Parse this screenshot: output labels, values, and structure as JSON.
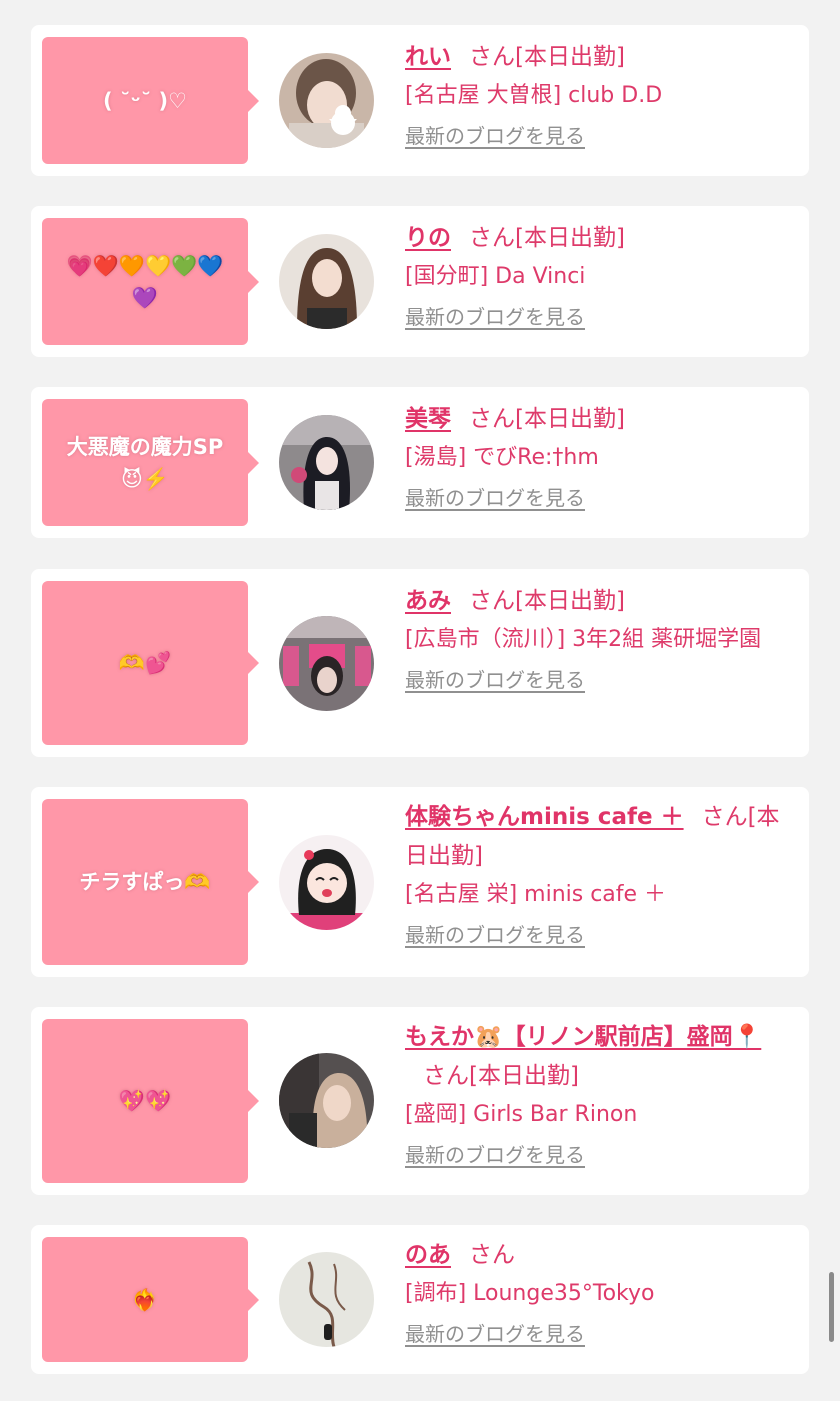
{
  "colors": {
    "bubble": "#ff97a8",
    "accent": "#e03468",
    "link_gray": "#909090",
    "background": "#f2f2f2"
  },
  "entries": [
    {
      "bubble_lines": [
        "( ˘ᵕ˘ )♡"
      ],
      "avatar_icon": "portrait-photo",
      "name": "れい",
      "san": "さん",
      "status": "[本日出勤]",
      "shop": "[名古屋 大曽根] club D.D",
      "blog_link": "最新のブログを見る"
    },
    {
      "bubble_lines": [
        "💗❤️🧡💛💚💙",
        "💜"
      ],
      "avatar_icon": "portrait-photo",
      "name": "りの",
      "san": "さん",
      "status": "[本日出勤]",
      "shop": "[国分町] Da Vinci",
      "blog_link": "最新のブログを見る"
    },
    {
      "bubble_lines": [
        "大悪魔の魔力SP",
        "😈⚡️"
      ],
      "avatar_icon": "portrait-photo",
      "name": "美琴",
      "san": "さん",
      "status": "[本日出勤]",
      "shop": "[湯島] でびRe:†hm",
      "blog_link": "最新のブログを見る"
    },
    {
      "bubble_lines": [
        "🫶💕"
      ],
      "avatar_icon": "portrait-photo",
      "name": "あみ",
      "san": "さん",
      "status": "[本日出勤]",
      "shop": "[広島市（流川）] 3年2組 薬研堀学園",
      "blog_link": "最新のブログを見る"
    },
    {
      "bubble_lines": [
        "チラすぱっ🫶"
      ],
      "avatar_icon": "illustration-avatar",
      "name": "体験ちゃんminis cafe ＋",
      "san": "さん",
      "status": "[本日出勤]",
      "shop": "[名古屋 栄] minis cafe ＋",
      "blog_link": "最新のブログを見る"
    },
    {
      "bubble_lines": [
        "💖💖"
      ],
      "avatar_icon": "portrait-photo",
      "name": "もえか🐹【リノン駅前店】盛岡📍",
      "san": "さん",
      "status": "[本日出勤]",
      "shop": "[盛岡] Girls Bar Rinon",
      "blog_link": "最新のブログを見る"
    },
    {
      "bubble_lines": [
        "❤️‍🔥"
      ],
      "avatar_icon": "abstract-photo",
      "name": "のあ",
      "san": "さん",
      "status": "",
      "shop": "[調布] Lounge35°Tokyo",
      "blog_link": "最新のブログを見る"
    }
  ]
}
